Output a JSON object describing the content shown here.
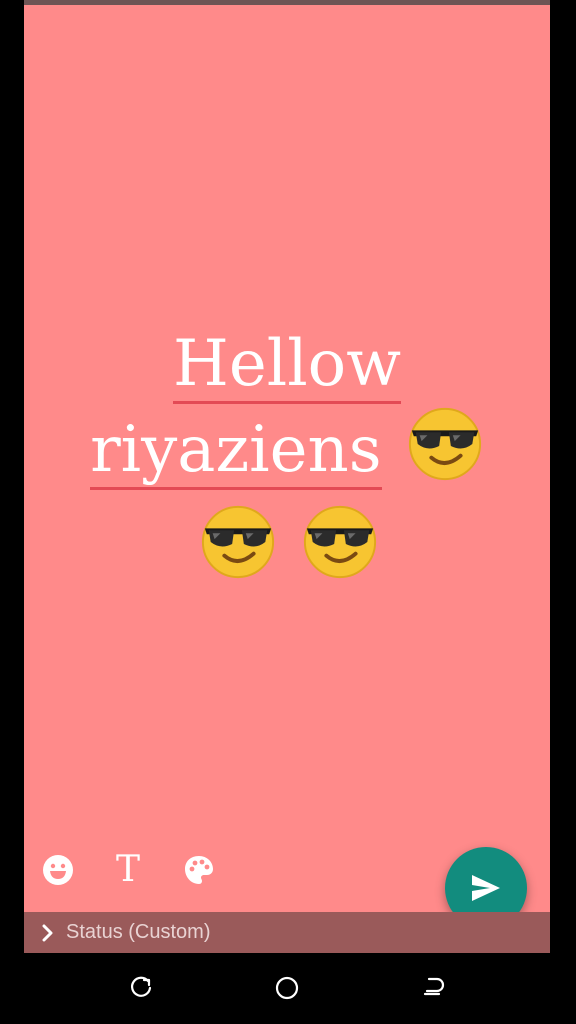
{
  "status_editor": {
    "line1": "Hellow",
    "line2": "riyaziens",
    "emojis": [
      "cool-sunglasses-emoji",
      "cool-sunglasses-emoji",
      "cool-sunglasses-emoji"
    ],
    "background_color": "#ff8a8a",
    "underline_color": "#e34a55"
  },
  "toolbar": {
    "emoji_icon": "smiley-icon",
    "text_tool_label": "T",
    "palette_icon": "palette-icon"
  },
  "send_button": {
    "icon": "send-icon",
    "color": "#128c7e"
  },
  "caption_bar": {
    "label": "Status (Custom)",
    "icon": "chevron-right-icon"
  },
  "navigation_bar": {
    "items": [
      "recents-icon",
      "home-icon",
      "back-icon"
    ]
  }
}
